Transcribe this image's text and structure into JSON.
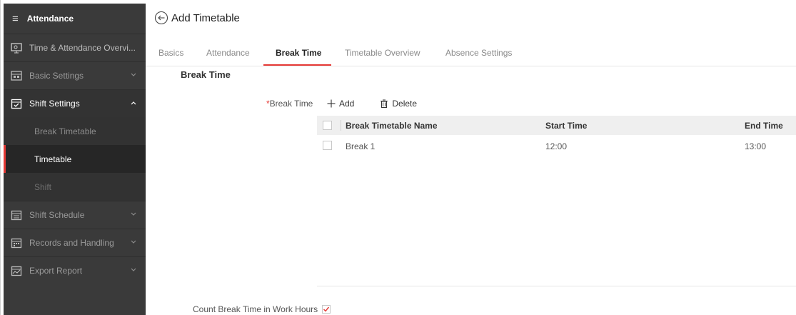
{
  "sidebar": {
    "header": "Attendance",
    "items": [
      {
        "label": "Time & Attendance Overvi...",
        "icon": "overview-icon"
      },
      {
        "label": "Basic Settings",
        "icon": "settings-icon"
      },
      {
        "label": "Shift Settings",
        "icon": "calendar-check-icon"
      },
      {
        "label": "Shift Schedule",
        "icon": "schedule-icon"
      },
      {
        "label": "Records and Handling",
        "icon": "records-icon"
      },
      {
        "label": "Export Report",
        "icon": "report-icon"
      }
    ],
    "sub_items": [
      "Break Timetable",
      "Timetable",
      "Shift"
    ]
  },
  "page": {
    "title": "Add Timetable",
    "tabs": [
      "Basics",
      "Attendance",
      "Break Time",
      "Timetable Overview",
      "Absence Settings"
    ],
    "active_tab": "Break Time",
    "section_title": "Break Time"
  },
  "form": {
    "required_mark": "*",
    "break_time_label": "Break Time",
    "add_label": "Add",
    "delete_label": "Delete",
    "count_break_label": "Count Break Time in Work Hours",
    "count_break_checked": true
  },
  "table": {
    "columns": [
      "Break Timetable Name",
      "Start Time",
      "End Time"
    ],
    "rows": [
      {
        "name": "Break 1",
        "start": "12:00",
        "end": "13:00"
      }
    ]
  },
  "colors": {
    "accent": "#e53935",
    "sidebar_bg": "#3a3a3a",
    "active_item_bg": "#262626"
  }
}
